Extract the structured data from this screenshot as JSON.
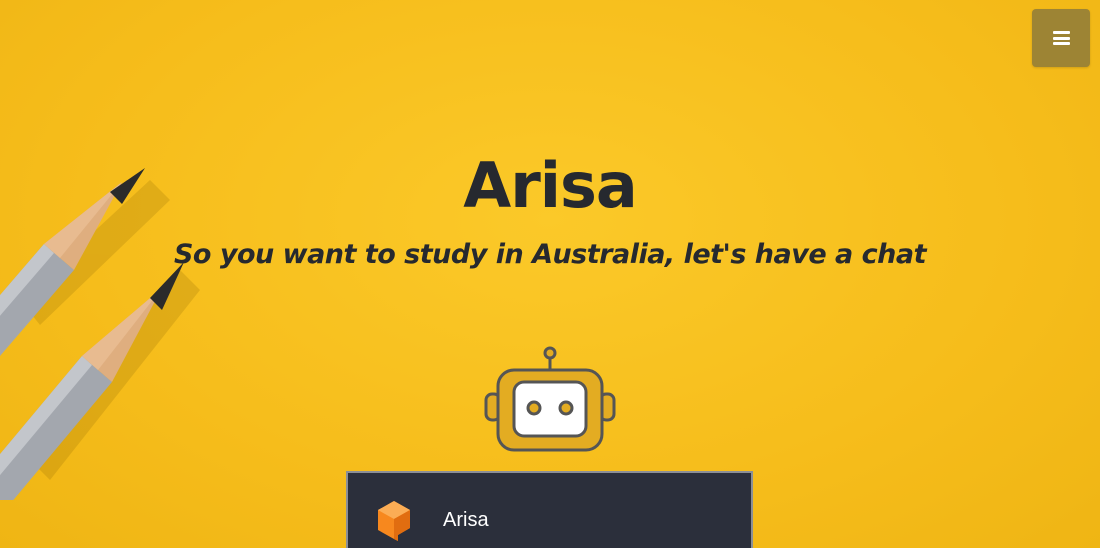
{
  "header": {
    "menu_button": {
      "icon": "hamburger-menu-icon",
      "color": "#9d8434"
    }
  },
  "hero": {
    "title": "Arisa",
    "subtitle": "So you want to study in Australia, let's have a chat",
    "background_color": "#f6bd1b",
    "text_color": "#26292f"
  },
  "decor": {
    "pencils_icon": "pencils-illustration",
    "logo_icon": "robot-icon",
    "logo_color": "#e3ac22"
  },
  "chat_widget": {
    "bot_name": "Arisa",
    "icon": "dialogflow-icon",
    "background_color": "#2b2f3b",
    "icon_color": "#f7881e"
  }
}
